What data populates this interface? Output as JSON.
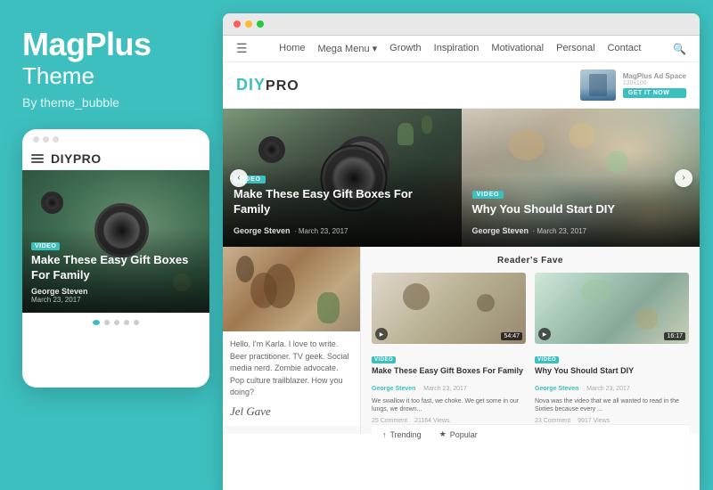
{
  "brand": {
    "name": "MagPlus",
    "subtitle": "Theme",
    "by": "By theme_bubble"
  },
  "mobile": {
    "logo_text": "DIYPRO",
    "logo_color": "DIY",
    "hero_badge": "VIDEO",
    "hero_title": "Make These Easy Gift Boxes For Family",
    "author": "George Steven",
    "date": "March 23, 2017"
  },
  "browser": {
    "nav": {
      "home": "Home",
      "mega_menu": "Mega Menu",
      "growth": "Growth",
      "inspiration": "Inspiration",
      "motivational": "Motivational",
      "personal": "Personal",
      "contact": "Contact"
    },
    "logo": "DIYPRO",
    "ad": {
      "label": "MagPlus Ad Space",
      "size": "120x100",
      "btn": "GET IT NOW"
    },
    "slides": [
      {
        "badge": "VIDEO",
        "title": "Make These Easy Gift Boxes For Family",
        "author": "George Steven",
        "date": "March 23, 2017"
      },
      {
        "badge": "VIDEO",
        "title": "Why You Should Start DIY",
        "author": "George Steven",
        "date": "March 23, 2017"
      }
    ],
    "blog_post": {
      "text": "Hello, I'm Karla. I love to write. Beer practitioner. TV geek. Social media nerd. Zombie advocate. Pop culture trailblazer. How you doing?"
    },
    "readers_fave": {
      "section_title": "Reader's Fave",
      "cards": [
        {
          "badge": "VIDEO",
          "title": "Make These Easy Gift Boxes For Family",
          "author": "George Steven",
          "date": "March 23, 2017",
          "description": "We swallow it too fast, we choke. We get some in our lungs, we drown...",
          "stat1": "25 Comment",
          "stat2": "21164 Views",
          "duration": "54:47"
        },
        {
          "badge": "VIDEO",
          "title": "Why You Should Start DIY",
          "author": "George Steven",
          "date": "March 23, 2017",
          "description": "Nova was the video that we all wanted to read in the Sixties because every ...",
          "stat1": "23 Comment",
          "stat2": "9917 Views",
          "duration": "16:17"
        }
      ]
    },
    "trending": {
      "label1": "Trending",
      "label2": "Popular"
    }
  }
}
